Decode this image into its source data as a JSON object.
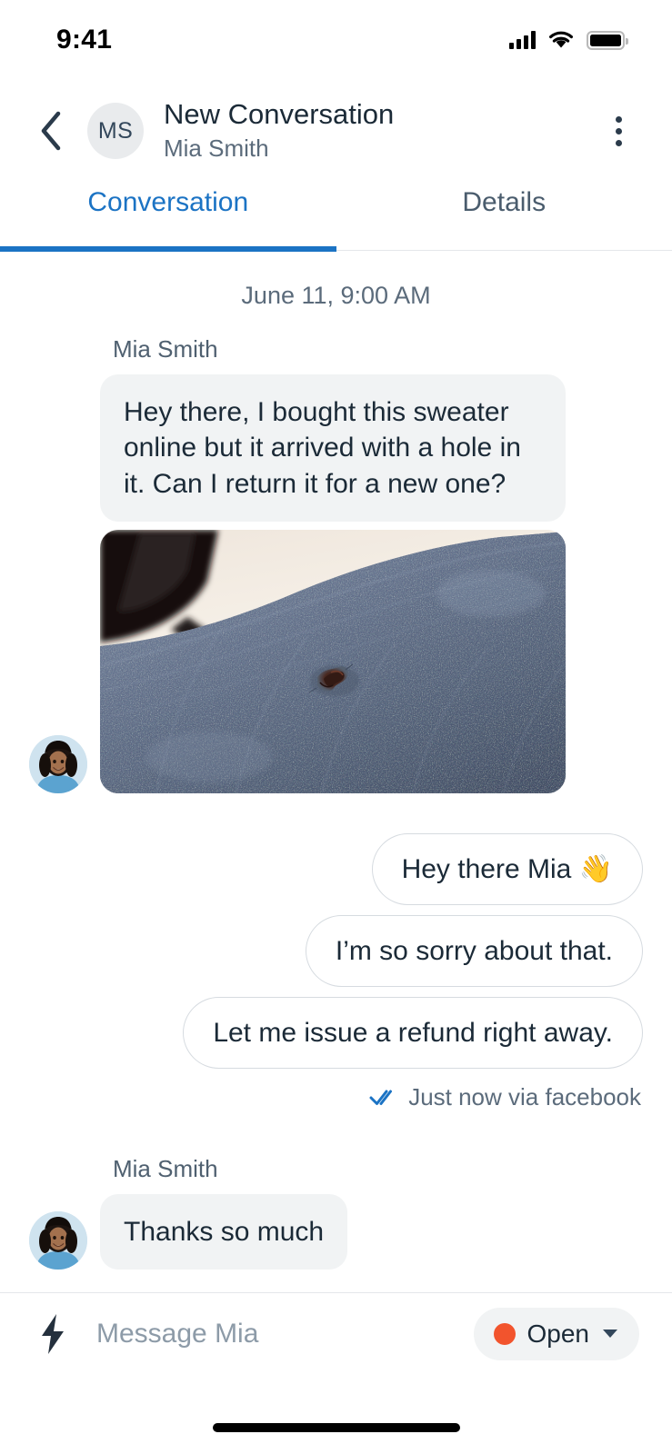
{
  "status_bar": {
    "time": "9:41",
    "signal_icon": "cellular-signal-icon",
    "wifi_icon": "wifi-icon",
    "battery_icon": "battery-full-icon"
  },
  "header": {
    "back_icon": "chevron-left-icon",
    "avatar_initials": "MS",
    "title": "New Conversation",
    "subtitle": "Mia Smith",
    "menu_icon": "kebab-menu-icon"
  },
  "tabs": [
    {
      "label": "Conversation",
      "active": true
    },
    {
      "label": "Details",
      "active": false
    }
  ],
  "thread": {
    "day_label": "June 11, 9:00 AM",
    "incoming_first": {
      "sender": "Mia Smith",
      "text": "Hey there, I bought this sweater online but it arrived with a hole in it. Can I return it for a new one?",
      "attachment_alt": "photo of blue knit sweater with a hole"
    },
    "outgoing": [
      "Hey there Mia 👋",
      "I’m so sorry about that.",
      "Let me issue a refund right away."
    ],
    "receipt": {
      "icon": "double-check-icon",
      "text": "Just now via facebook"
    },
    "incoming_last": {
      "sender": "Mia Smith",
      "text": "Thanks so much"
    }
  },
  "composer": {
    "bolt_icon": "lightning-bolt-icon",
    "placeholder": "Message Mia",
    "input_value": "",
    "status_label": "Open",
    "status_color": "#f2542d",
    "caret_icon": "chevron-down-icon"
  },
  "colors": {
    "accent": "#1b73c4",
    "incoming_bubble": "#f1f3f4",
    "text_primary": "#1b2a37",
    "text_secondary": "#5b6b7b",
    "read_check": "#1b73c4"
  },
  "home_indicator": "home-indicator"
}
